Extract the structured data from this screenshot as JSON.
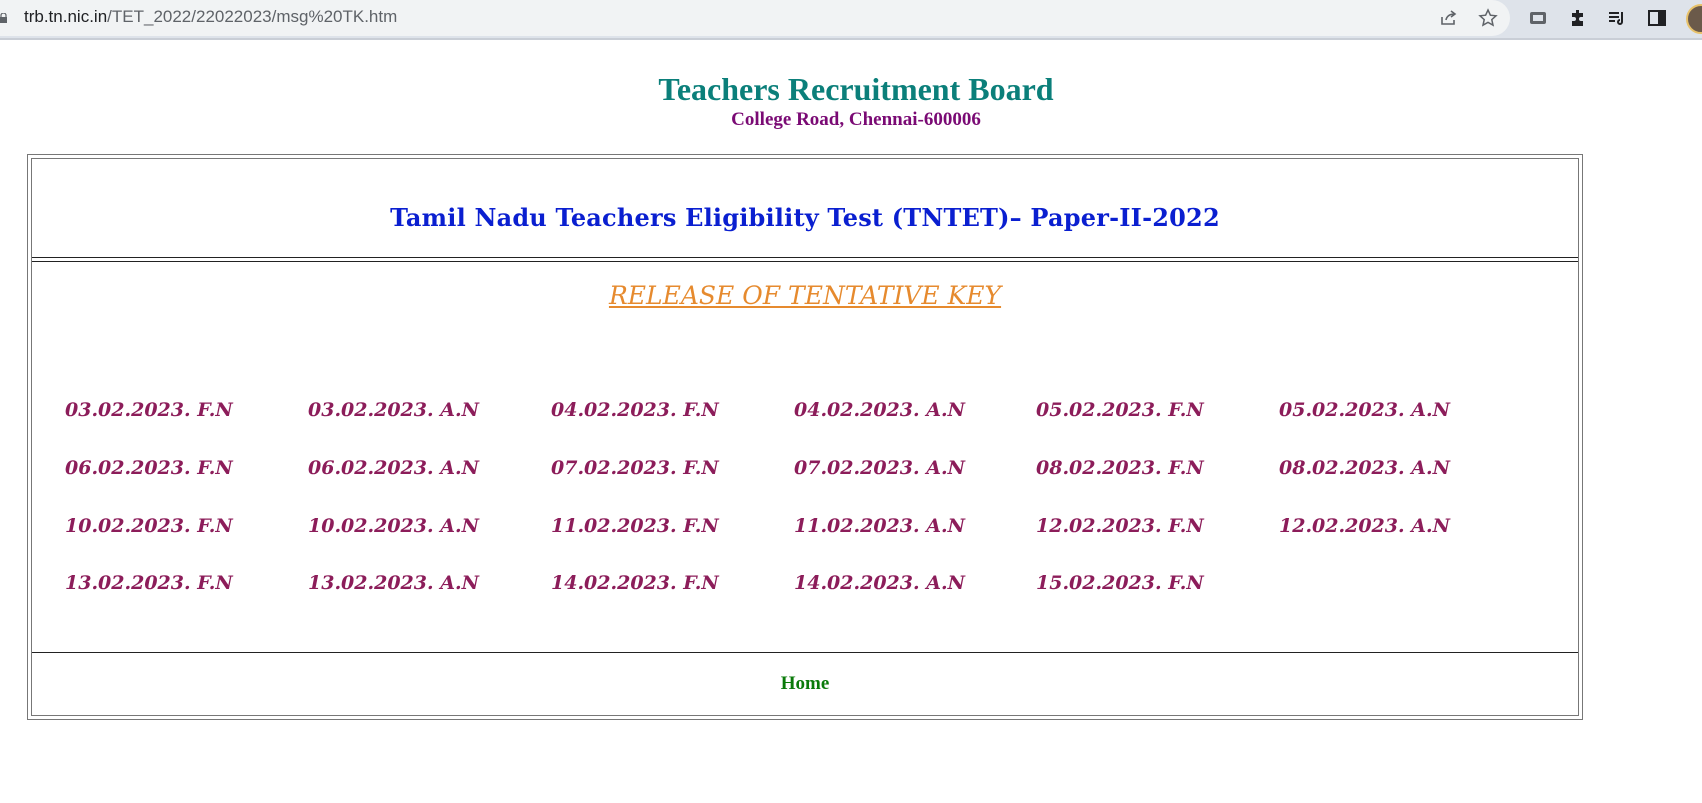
{
  "browser": {
    "url_host": "trb.tn.nic.in",
    "url_path": "/TET_2022/22022023/msg%20TK.htm",
    "icons": [
      "share-icon",
      "star-icon",
      "tab-search-icon",
      "extensions-icon",
      "reading-list-icon",
      "side-panel-icon"
    ]
  },
  "header": {
    "title": "Teachers Recruitment Board",
    "address": "College Road, Chennai-600006"
  },
  "exam": {
    "title": "Tamil Nadu Teachers Eligibility Test (TNTET)– Paper-II-2022",
    "release_heading": "RELEASE OF TENTATIVE KEY"
  },
  "sessions": [
    [
      "03.02.2023. F.N",
      "03.02.2023. A.N",
      "04.02.2023. F.N",
      "04.02.2023. A.N",
      "05.02.2023. F.N",
      "05.02.2023. A.N"
    ],
    [
      "06.02.2023. F.N",
      "06.02.2023. A.N",
      "07.02.2023. F.N",
      "07.02.2023. A.N",
      "08.02.2023. F.N",
      "08.02.2023. A.N"
    ],
    [
      "10.02.2023. F.N",
      "10.02.2023. A.N",
      "11.02.2023. F.N",
      "11.02.2023. A.N",
      "12.02.2023. F.N",
      "12.02.2023. A.N"
    ],
    [
      "13.02.2023. F.N",
      "13.02.2023. A.N",
      "14.02.2023. F.N",
      "14.02.2023. A.N",
      "15.02.2023. F.N"
    ]
  ],
  "footer": {
    "home_label": "Home"
  }
}
